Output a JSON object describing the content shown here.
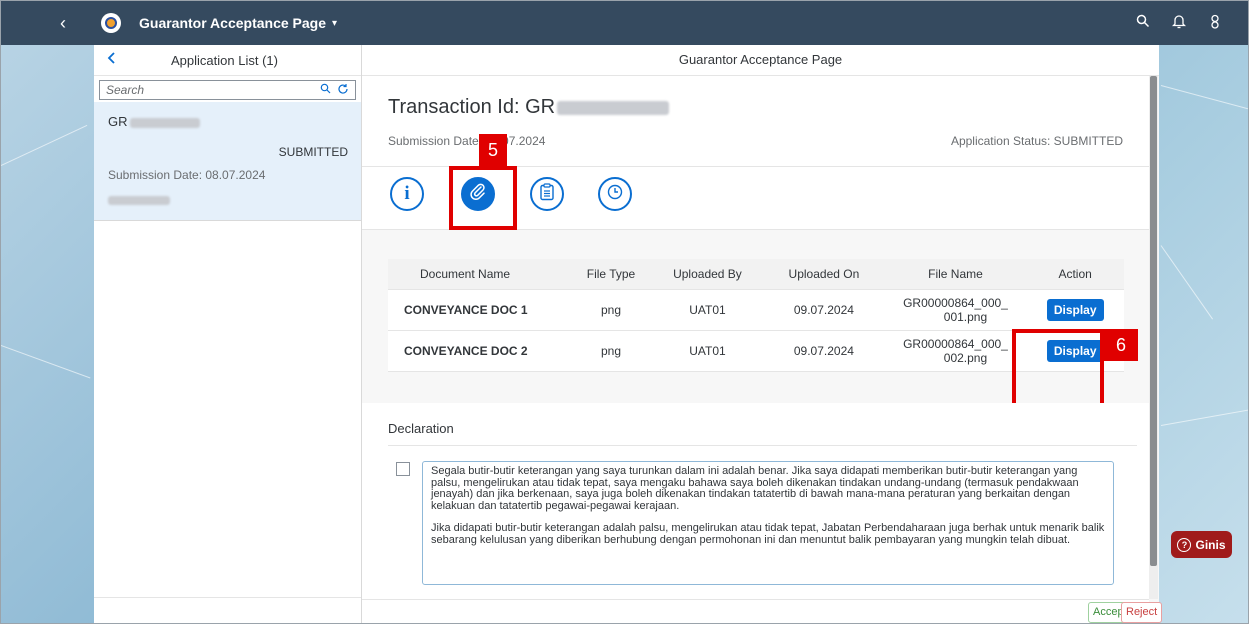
{
  "shell": {
    "title": "Guarantor Acceptance Page",
    "caret": "▾",
    "back": "‹",
    "icons": [
      "search-icon",
      "bell-icon",
      "user-icon"
    ]
  },
  "master": {
    "title": "Application List (1)",
    "search_placeholder": "Search",
    "item": {
      "id_prefix": "GR",
      "status": "SUBMITTED",
      "submission_date": "Submission Date: 08.07.2024"
    }
  },
  "detail": {
    "header": "Guarantor Acceptance Page",
    "transaction": "Transaction Id: GR",
    "submission_date": "Submission Date: 09.07.2024",
    "app_status": "Application Status: SUBMITTED",
    "tabs": [
      "info-icon",
      "attachment-icon",
      "notes-icon",
      "history-icon"
    ],
    "callout5": "5",
    "callout6": "6",
    "table": {
      "headers": [
        "Document Name",
        "File Type",
        "Uploaded By",
        "Uploaded On",
        "File Name",
        "Action"
      ],
      "rows": [
        {
          "name": "CONVEYANCE DOC 1",
          "type": "png",
          "by": "UAT01",
          "on": "09.07.2024",
          "file1": "GR00000864_000_",
          "file2": "001.png",
          "action": "Display"
        },
        {
          "name": "CONVEYANCE DOC 2",
          "type": "png",
          "by": "UAT01",
          "on": "09.07.2024",
          "file1": "GR00000864_000_",
          "file2": "002.png",
          "action": "Display"
        }
      ]
    },
    "declaration": {
      "title": "Declaration",
      "p1": "Segala butir-butir keterangan yang saya turunkan dalam ini adalah benar. Jika saya didapati memberikan butir-butir keterangan yang palsu, mengelirukan atau tidak tepat, saya mengaku bahawa saya boleh dikenakan tindakan undang-undang (termasuk pendakwaan jenayah) dan jika berkenaan, saya juga boleh dikenakan tindakan tatatertib di bawah mana-mana peraturan yang berkaitan dengan kelakuan dan tatatertib pegawai-pegawai kerajaan.",
      "p2": "Jika didapati butir-butir keterangan adalah palsu, mengelirukan atau tidak tepat, Jabatan Perbendaharaan juga berhak untuk menarik balik sebarang kelulusan yang diberikan berhubung dengan permohonan ini dan menuntut balik pembayaran yang mungkin telah dibuat."
    },
    "buttons": {
      "accept": "Accept",
      "reject": "Reject"
    }
  },
  "ginis": {
    "label": "Ginis",
    "icon": "?"
  },
  "colors": {
    "shell": "#354a5f",
    "accent": "#0a6ed1",
    "callout": "#e00000",
    "ginis": "#a01b1b",
    "accept": "#3a8d3a",
    "reject": "#c84040"
  }
}
